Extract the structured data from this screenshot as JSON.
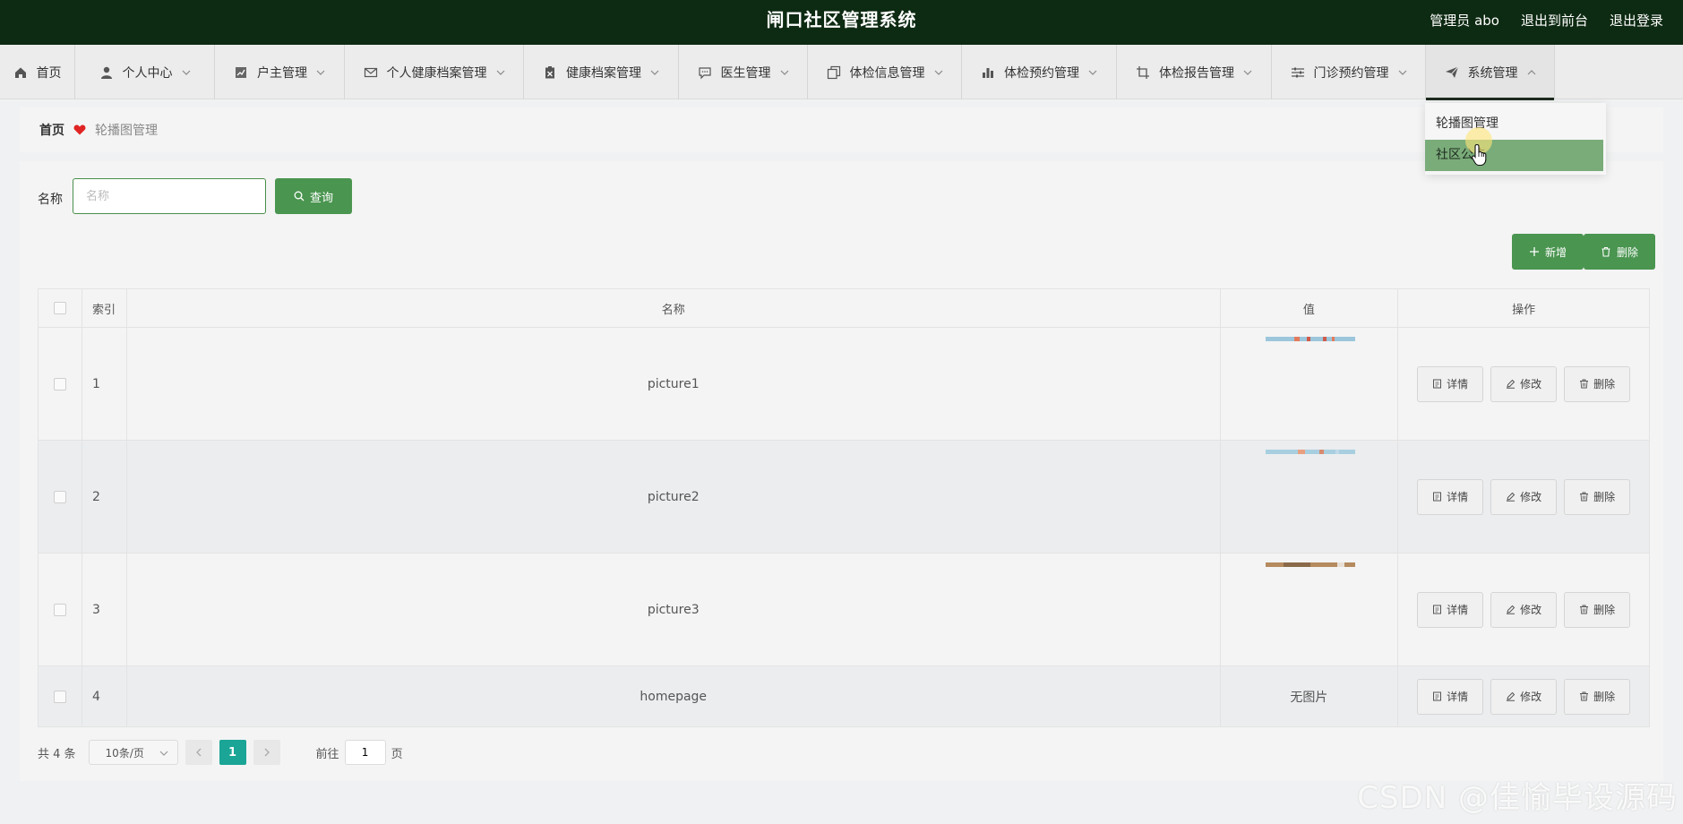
{
  "header": {
    "title": "闸口社区管理系统",
    "admin_label": "管理员 abo",
    "to_front_label": "退出到前台",
    "logout_label": "退出登录"
  },
  "nav": {
    "items": [
      {
        "label": "首页",
        "icon": "home-icon"
      },
      {
        "label": "个人中心",
        "icon": "user-icon"
      },
      {
        "label": "户主管理",
        "icon": "chart-icon"
      },
      {
        "label": "个人健康档案管理",
        "icon": "mail-icon"
      },
      {
        "label": "健康档案管理",
        "icon": "clipboard-icon"
      },
      {
        "label": "医生管理",
        "icon": "chat-icon"
      },
      {
        "label": "体检信息管理",
        "icon": "copy-icon"
      },
      {
        "label": "体检预约管理",
        "icon": "bar-chart-icon"
      },
      {
        "label": "体检报告管理",
        "icon": "crop-icon"
      },
      {
        "label": "门诊预约管理",
        "icon": "sliders-icon"
      },
      {
        "label": "系统管理",
        "icon": "send-icon"
      }
    ],
    "dropdown": [
      "轮播图管理",
      "社区公告"
    ]
  },
  "breadcrumb": {
    "home": "首页",
    "current": "轮播图管理"
  },
  "search": {
    "label": "名称",
    "placeholder": "名称",
    "query_label": "查询"
  },
  "toolbar": {
    "add_label": "新增",
    "delete_label": "删除"
  },
  "table": {
    "headers": {
      "index": "索引",
      "name": "名称",
      "value": "值",
      "ops": "操作"
    },
    "rows": [
      {
        "index": "1",
        "name": "picture1",
        "value": ""
      },
      {
        "index": "2",
        "name": "picture2",
        "value": ""
      },
      {
        "index": "3",
        "name": "picture3",
        "value": ""
      },
      {
        "index": "4",
        "name": "homepage",
        "value": "无图片"
      }
    ],
    "op_labels": {
      "detail": "详情",
      "edit": "修改",
      "delete": "删除"
    }
  },
  "pager": {
    "total": "共 4 条",
    "page_size": "10条/页",
    "current": "1",
    "goto_prefix": "前往",
    "goto_value": "1",
    "goto_suffix": "页"
  },
  "watermark": "CSDN @佳愉毕设源码",
  "colors": {
    "header_bg": "#0d2a12",
    "accent": "#4a9550",
    "pager_active": "#1aa596",
    "dropdown_hover": "#7aac7a"
  }
}
